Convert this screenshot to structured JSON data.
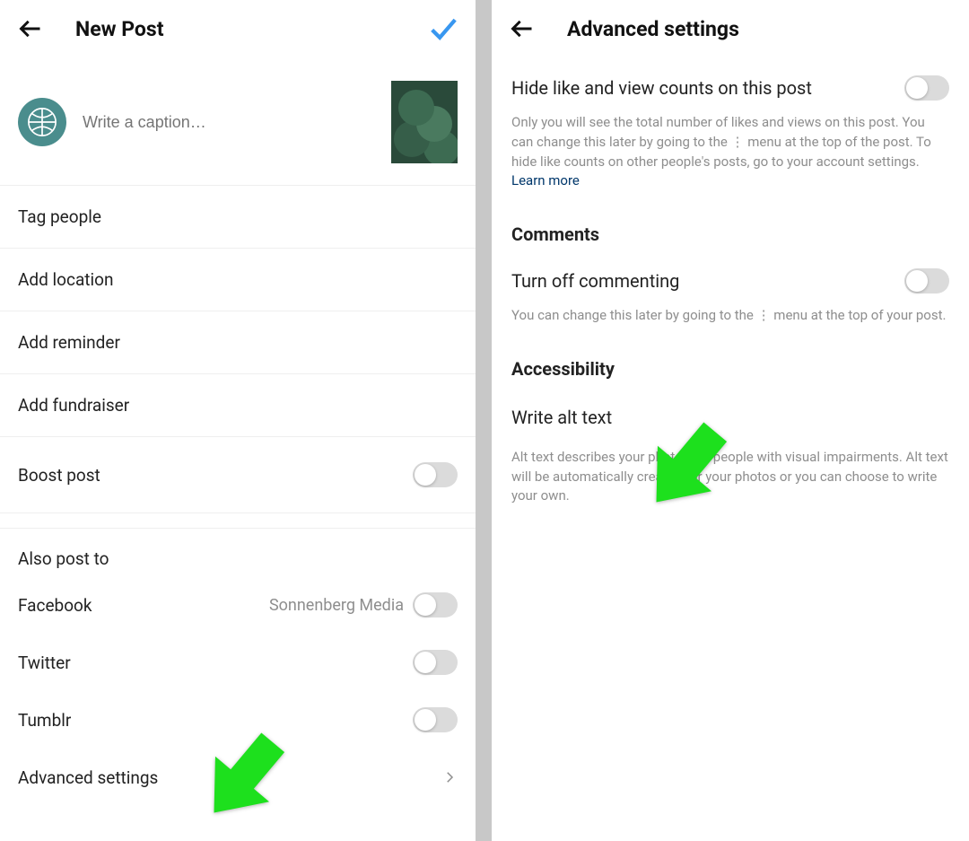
{
  "left": {
    "header_title": "New Post",
    "caption_placeholder": "Write a caption…",
    "rows": {
      "tag_people": "Tag people",
      "add_location": "Add location",
      "add_reminder": "Add reminder",
      "add_fundraiser": "Add fundraiser",
      "boost_post": "Boost post"
    },
    "also_post_to": "Also post to",
    "share": {
      "facebook": "Facebook",
      "facebook_account": "Sonnenberg Media",
      "twitter": "Twitter",
      "tumblr": "Tumblr"
    },
    "advanced_settings": "Advanced settings"
  },
  "right": {
    "header_title": "Advanced settings",
    "hide_counts": {
      "label": "Hide like and view counts on this post",
      "desc_part1": "Only you will see the total number of likes and views on this post. You can change this later by going to the ⋮ menu at the top of the post. To hide like counts on other people's posts, go to your account settings. ",
      "learn_more": "Learn more"
    },
    "comments_heading": "Comments",
    "turn_off_commenting": {
      "label": "Turn off commenting",
      "desc": "You can change this later by going to the ⋮ menu at the top of your post."
    },
    "accessibility_heading": "Accessibility",
    "write_alt_text": {
      "label": "Write alt text",
      "desc": "Alt text describes your photos for people with visual impairments. Alt text will be automatically created for your photos or you can choose to write your own."
    }
  }
}
